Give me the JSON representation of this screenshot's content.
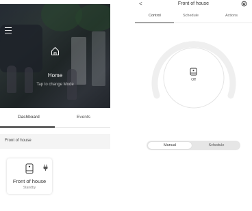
{
  "dashboard": {
    "mode": {
      "title": "Home",
      "subtitle": "Tap to change Mode"
    },
    "tabs": [
      {
        "label": "Dashboard",
        "active": true
      },
      {
        "label": "Events",
        "active": false
      }
    ],
    "section_label": "Front of house",
    "device": {
      "name": "Front of house",
      "status": "Standby",
      "icon": "smart-plug-icon"
    }
  },
  "device_control": {
    "back_label": "<",
    "title": "Front of house",
    "tabs": [
      {
        "label": "Control",
        "active": true
      },
      {
        "label": "Schedule",
        "active": false
      },
      {
        "label": "Actions",
        "active": false
      }
    ],
    "state_label": "Off",
    "mode_options": [
      {
        "label": "Manual",
        "selected": true
      },
      {
        "label": "Schedule",
        "selected": false
      }
    ]
  },
  "colors": {
    "accent": "#333333",
    "segment_bg": "#e6e6e6",
    "dial_ring": "#efefef"
  }
}
